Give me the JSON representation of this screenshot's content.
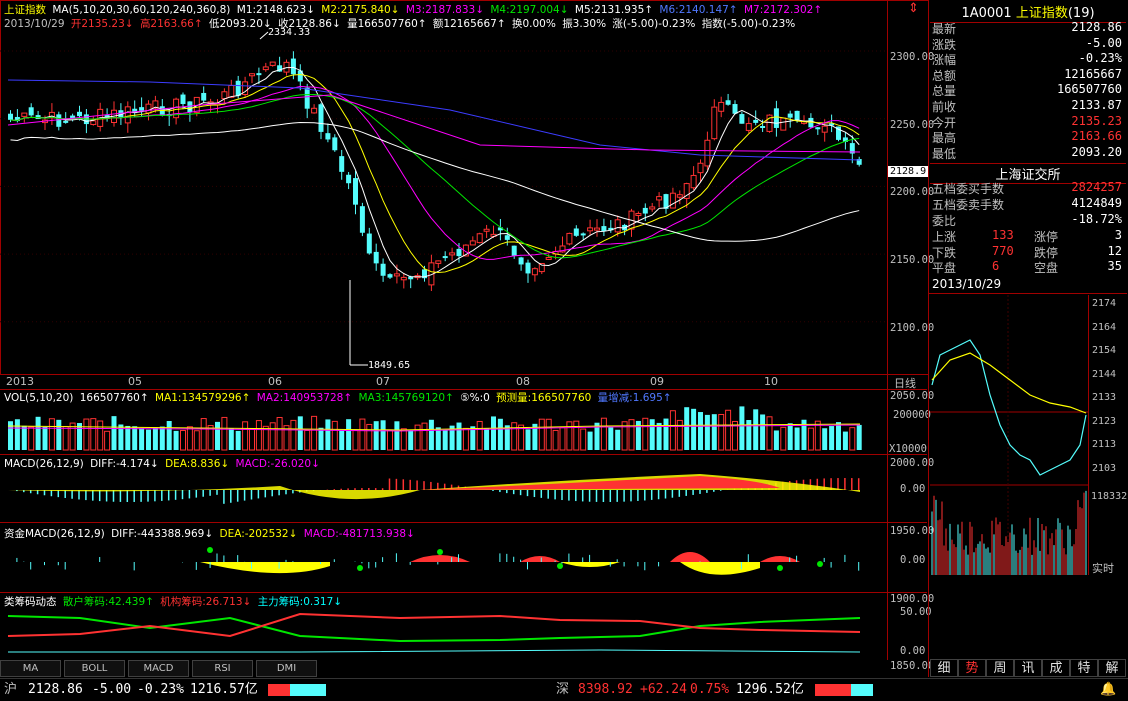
{
  "colors": {
    "up": "#ff3232",
    "down": "#54fcfc",
    "bg": "#000000",
    "border": "#a00000",
    "yellow": "#ffff00",
    "magenta": "#ff00ff",
    "green": "#00e600",
    "blue": "#3c3cff"
  },
  "main": {
    "title": "上证指数",
    "ma_params": "MA(5,10,20,30,60,120,240,360,8)",
    "ma_values": [
      "M1:2148.623↓",
      "M2:2175.840↓",
      "M3:2187.833↓",
      "M4:2197.004↓",
      "M5:2131.935↑",
      "M6:2140.147↑",
      "M7:2172.302↑"
    ],
    "date_line": {
      "date": "2013/10/29",
      "open": "开2135.23↓",
      "high": "高2163.66↑",
      "low": "低2093.20↓",
      "close": "收2128.86↓",
      "vol": "量166507760↑",
      "amount": "额12165667↑",
      "turnover": "换0.00%",
      "amplitude": "振3.30%",
      "change": "涨(-5.00)-0.23%",
      "index": "指数(-5.00)-0.23%"
    },
    "price_axis": [
      "2300.00",
      "2250.00",
      "2200.00",
      "2150.00",
      "2100.00",
      "2050.00",
      "2000.00",
      "1950.00",
      "1900.00",
      "1850.00"
    ],
    "current_price_tag": "2128.9",
    "high_annotation": "2334.33",
    "low_annotation": "1849.65",
    "months": [
      "2013",
      "05",
      "06",
      "07",
      "08",
      "09",
      "10"
    ],
    "period_label": "日线"
  },
  "vol": {
    "header": "VOL(5,10,20)",
    "v": "166507760↑",
    "ma1": "MA1:134579296↑",
    "ma2": "MA2:140953728↑",
    "ma3": "MA3:145769120↑",
    "forecast_icon": "⑤%:0",
    "forecast": "预测量:166507760",
    "ratio": "量增减:1.695↑",
    "axis_top": "200000",
    "axis_unit": "X10000"
  },
  "macd": {
    "header": "MACD(26,12,9)",
    "diff": "DIFF:-4.174↓",
    "dea": "DEA:8.836↓",
    "macd": "MACD:-26.020↓",
    "axis": "0.00"
  },
  "fund_macd": {
    "header": "资金MACD(26,12,9)",
    "diff": "DIFF:-443388.969↓",
    "dea": "DEA:-202532↓",
    "macd": "MACD:-481713.938↓",
    "axis": "0.00"
  },
  "chip": {
    "header": "类筹码动态",
    "retail": "散户筹码:42.439↑",
    "inst": "机构筹码:26.713↓",
    "main": "主力筹码:0.317↓",
    "axis_top": "50.00",
    "axis_bottom": "0.00"
  },
  "tabs": [
    "MA",
    "BOLL",
    "MACD",
    "RSI",
    "DMI"
  ],
  "side": {
    "code": "1A0001",
    "name": "上证指数",
    "count": "(19)",
    "rows": [
      {
        "k": "最新",
        "v": "2128.86",
        "c": "wht"
      },
      {
        "k": "涨跌",
        "v": "-5.00",
        "c": "wht"
      },
      {
        "k": "涨幅",
        "v": "-0.23%",
        "c": "wht"
      },
      {
        "k": "总额",
        "v": "12165667",
        "c": "wht"
      },
      {
        "k": "总量",
        "v": "166507760",
        "c": "wht"
      },
      {
        "k": "前收",
        "v": "2133.87",
        "c": "wht"
      },
      {
        "k": "今开",
        "v": "2135.23",
        "c": "red"
      },
      {
        "k": "最高",
        "v": "2163.66",
        "c": "red"
      },
      {
        "k": "最低",
        "v": "2093.20",
        "c": "wht"
      }
    ],
    "exchange": "上海证交所",
    "rows2": [
      {
        "k": "五档委买手数",
        "v": "2824257",
        "c": "red"
      },
      {
        "k": "五档委卖手数",
        "v": "4124849",
        "c": "wht"
      },
      {
        "k": "委比",
        "v": "-18.72%",
        "c": "wht"
      }
    ],
    "breadth": [
      {
        "k1": "上涨",
        "v1": "133",
        "k2": "涨停",
        "v2": "3"
      },
      {
        "k1": "下跌",
        "v1": "770",
        "k2": "跌停",
        "v2": "12"
      },
      {
        "k1": "平盘",
        "v1": "6",
        "k2": "空盘",
        "v2": "35"
      }
    ],
    "intraday_date": "2013/10/29",
    "intraday_axis": [
      "2174",
      "2164",
      "2154",
      "2144",
      "2133",
      "2123",
      "2113",
      "2103"
    ],
    "intraday_vol_top": "118332",
    "realtime": "实时",
    "nav": [
      "细",
      "势",
      "周",
      "讯",
      "成",
      "特",
      "解"
    ]
  },
  "status": {
    "sh_label": "沪",
    "sh_price": "2128.86",
    "sh_chg": "-5.00",
    "sh_pct": "-0.23%",
    "sh_amt": "1216.57亿",
    "sz_label": "深",
    "sz_price": "8398.92",
    "sz_chg": "+62.24",
    "sz_pct": "0.75%",
    "sz_amt": "1296.52亿"
  }
}
